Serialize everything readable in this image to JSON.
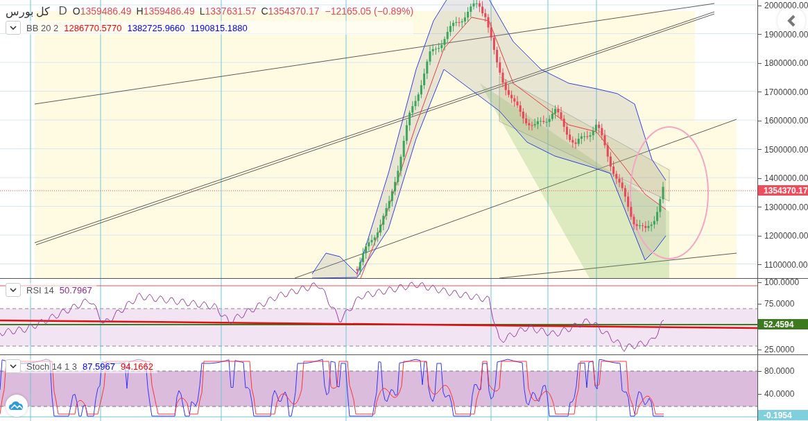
{
  "header": {
    "symbol": "کل بورس",
    "interval": "D",
    "ohlc": [
      {
        "label": "O",
        "value": "1359486.49"
      },
      {
        "label": "H",
        "value": "1359486.49"
      },
      {
        "label": "L",
        "value": "1337631.57"
      },
      {
        "label": "C",
        "value": "1354370.17"
      }
    ],
    "change": "−12165.05 (−0.89%)"
  },
  "panes": [
    {
      "kind": "price",
      "legend": {
        "name": "BB 20 2",
        "values": [
          {
            "text": "1286770.5770",
            "color": "#ff0000"
          },
          {
            "text": "1382725.9660",
            "color": "#0000ff"
          },
          {
            "text": "1190815.1880",
            "color": "#0000ff"
          }
        ]
      },
      "axis": {
        "ticks": [
          "2000000.00",
          "1900000.00",
          "1800000.00",
          "1700000.00",
          "1600000.00",
          "1500000.00",
          "1400000.00",
          "1300000.00",
          "1200000.00",
          "1100000.00"
        ],
        "badge": {
          "text": "1354370.17",
          "color": "#ef4d5c"
        }
      }
    },
    {
      "kind": "rsi",
      "legend": {
        "name": "RSI 14",
        "values": [
          {
            "text": "50.7967",
            "color": "#8e2a91"
          }
        ]
      },
      "axis": {
        "ticks": [
          "100.0000",
          "75.0000",
          "25.0000"
        ],
        "badge": {
          "text": "52.4594",
          "color": "#3b7a1e"
        }
      }
    },
    {
      "kind": "stoch",
      "legend": {
        "name": "Stoch 14 1 3",
        "values": [
          {
            "text": "87.5967",
            "color": "#0000ff"
          },
          {
            "text": "94.1662",
            "color": "#ff0000"
          }
        ]
      },
      "axis": {
        "ticks": [
          "80.0000",
          "40.0000"
        ],
        "badge": {
          "text": "-0.1954",
          "color": "#80cfdc"
        }
      }
    }
  ]
}
